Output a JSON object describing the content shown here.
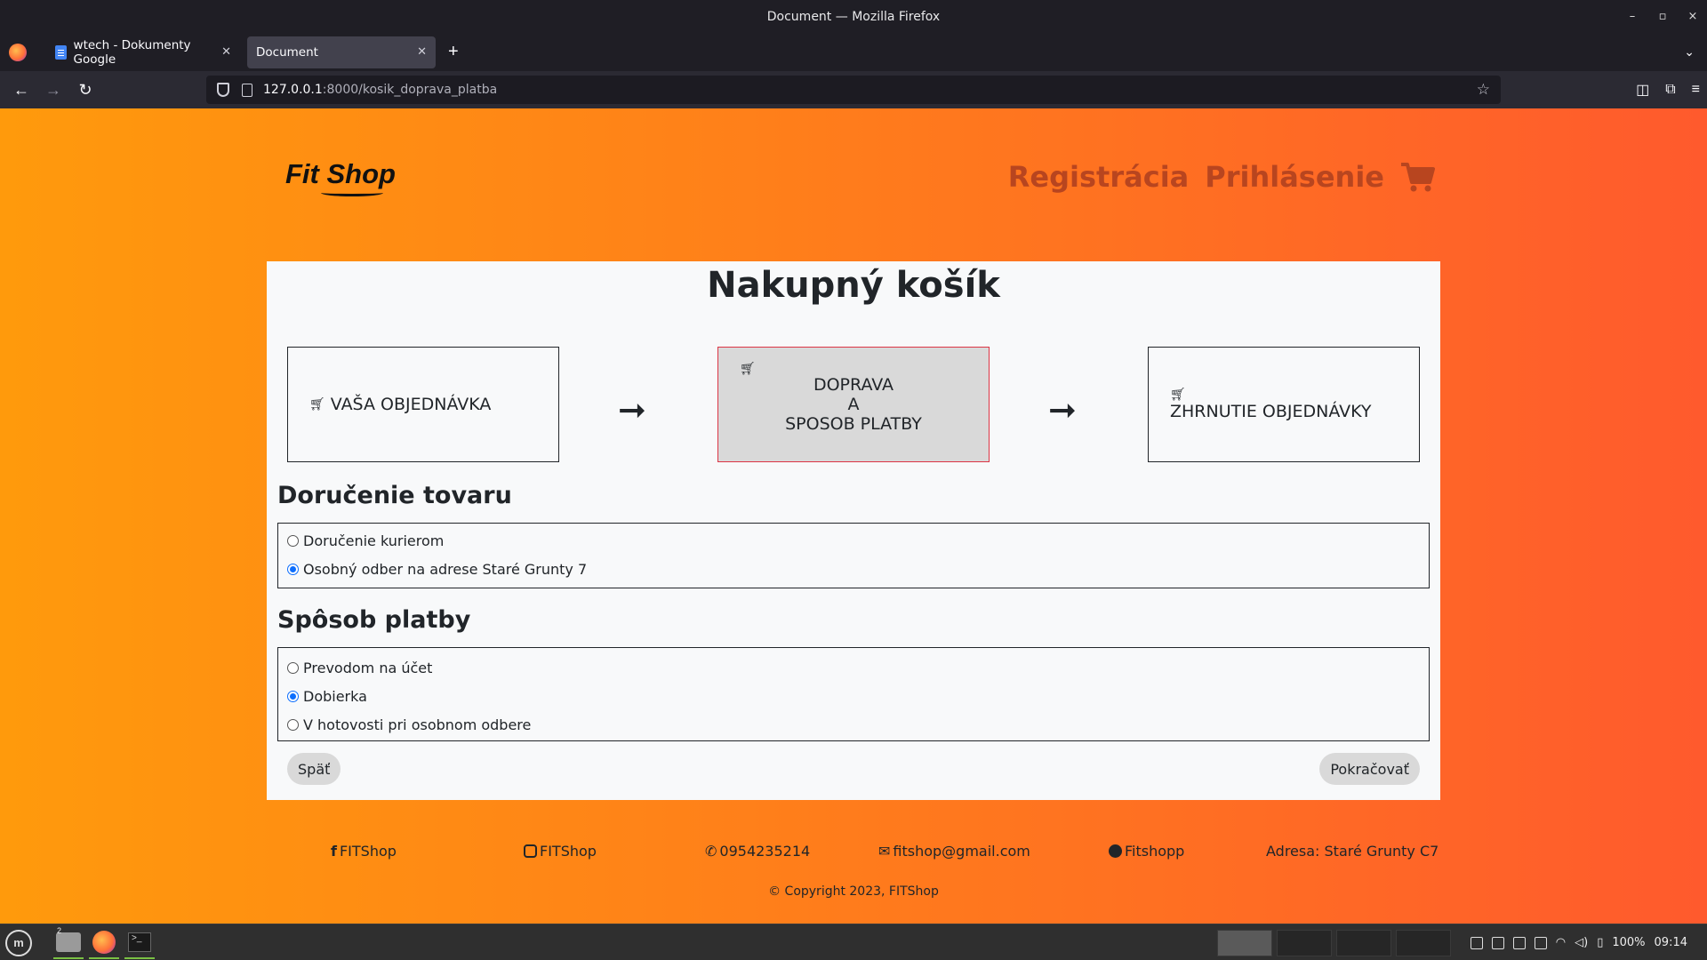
{
  "window": {
    "title": "Document — Mozilla Firefox",
    "controls": [
      "–",
      "▫",
      "×"
    ]
  },
  "tabs": [
    {
      "label": "wtech - Dokumenty Google",
      "icon": "google-docs-icon"
    },
    {
      "label": "Document",
      "icon": ""
    }
  ],
  "toolbar": {
    "url_host": "127.0.0.1",
    "url_path": ":8000/kosik_doprava_platba"
  },
  "site": {
    "brand": "Fit Shop",
    "nav": {
      "register": "Registrácia",
      "login": "Prihlásenie"
    }
  },
  "cart": {
    "title": "Nakupný košík",
    "steps": [
      {
        "label": "VAŠA OBJEDNÁVKA"
      },
      {
        "line1": "DOPRAVA",
        "line2": "A",
        "line3": "SPOSOB PLATBY"
      },
      {
        "label": "ZHRNUTIE OBJEDNÁVKY"
      }
    ],
    "delivery": {
      "title": "Doručenie tovaru",
      "options": [
        {
          "label": "Doručenie kurierom",
          "selected": false
        },
        {
          "label": "Osobný odber na adrese Staré Grunty 7",
          "selected": true
        }
      ]
    },
    "payment": {
      "title": "Spôsob platby",
      "options": [
        {
          "label": "Prevodom na účet",
          "selected": false
        },
        {
          "label": "Dobierka",
          "selected": true
        },
        {
          "label": "V hotovosti pri osobnom odbere",
          "selected": false
        }
      ]
    },
    "back_label": "Späť",
    "continue_label": "Pokračovať"
  },
  "footer": {
    "facebook": "FITShop",
    "instagram": "FITShop",
    "phone": "0954235214",
    "email": "fitshop@gmail.com",
    "snapchat": "Fitshopp",
    "address": "Adresa: Staré Grunty C7",
    "copyright": "© Copyright 2023, FITShop"
  },
  "taskbar": {
    "workspace_badge": "2",
    "battery": "100%",
    "time": "09:14"
  },
  "colors": {
    "page_gradient_start": "#ff9a0c",
    "page_gradient_end": "#ff5a2d",
    "nav_link": "#b8451f",
    "active_step_border": "#dc3545",
    "radio_selected": "#0d6efd"
  }
}
